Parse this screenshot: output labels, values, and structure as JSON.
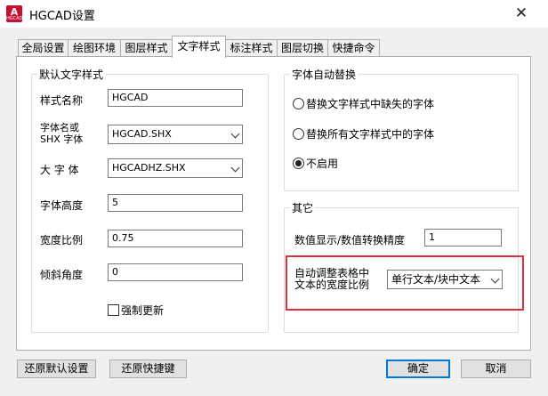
{
  "window": {
    "title": "HGCAD设置",
    "icon_text": "A",
    "icon_subtext": "HGCAD"
  },
  "tabs": [
    {
      "label": "全局设置"
    },
    {
      "label": "绘图环境"
    },
    {
      "label": "图层样式"
    },
    {
      "label": "文字样式",
      "active": true
    },
    {
      "label": "标注样式"
    },
    {
      "label": "图层切换"
    },
    {
      "label": "快捷命令"
    }
  ],
  "default_text_style": {
    "title": "默认文字样式",
    "style_name": {
      "label": "样式名称",
      "value": "HGCAD"
    },
    "font_name": {
      "label_line1": "字体名或",
      "label_line2": "SHX 字体",
      "value": "HGCAD.SHX"
    },
    "big_font": {
      "label": "大 字 体",
      "value": "HGCADHZ.SHX"
    },
    "font_height": {
      "label": "字体高度",
      "value": "5"
    },
    "width_ratio": {
      "label": "宽度比例",
      "value": "0.75"
    },
    "oblique_angle": {
      "label": "倾斜角度",
      "value": "0"
    },
    "force_update": {
      "label": "强制更新",
      "checked": false
    }
  },
  "font_auto_replace": {
    "title": "字体自动替换",
    "options": [
      {
        "label": "替换文字样式中缺失的字体",
        "selected": false
      },
      {
        "label": "替换所有文字样式中的字体",
        "selected": false
      },
      {
        "label": "不启用",
        "selected": true
      }
    ]
  },
  "other": {
    "title": "其它",
    "precision": {
      "label": "数值显示/数值转换精度",
      "value": "1"
    },
    "auto_adjust": {
      "label_line1": "自动调整表格中",
      "label_line2": "文本的宽度比例",
      "value": "单行文本/块中文本"
    }
  },
  "buttons": {
    "restore_defaults": "还原默认设置",
    "restore_shortcuts": "还原快捷键",
    "ok": "确定",
    "cancel": "取消"
  },
  "colors": {
    "highlight": "#e0303a",
    "default_button_border": "#0078d7"
  }
}
